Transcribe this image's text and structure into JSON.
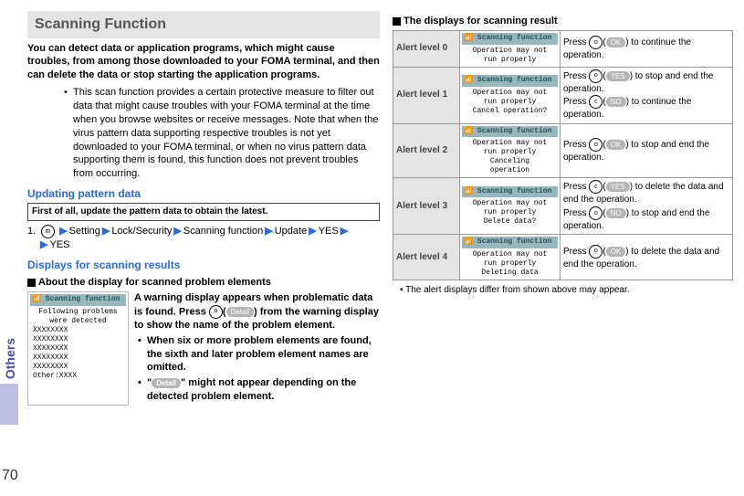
{
  "page_number": "70",
  "side_label": "Others",
  "left": {
    "title": "Scanning Function",
    "lead": "You can detect data or application programs, which might cause troubles, from among those downloaded to your FOMA terminal, and then can delete the data or stop starting the application programs.",
    "note": "This scan function provides a certain protective measure to filter out data that might cause troubles with your FOMA terminal at the time when you browse websites or receive messages. Note that when the virus pattern data supporting respective troubles is not yet downloaded to your FOMA terminal, or when no virus pattern data supporting them is found, this function does not prevent troubles from occurring.",
    "upd_heading": "Updating pattern data",
    "upd_box": "First of all, update the pattern data to obtain the latest.",
    "step_prefix": "1.",
    "icon_m": "m",
    "path": [
      "Setting",
      "Lock/Security",
      "Scanning function",
      "Update",
      "YES",
      "YES"
    ],
    "res_heading": "Displays for scanning results",
    "res_sub": "About the display for scanned problem elements",
    "phone": {
      "title": "Scanning function",
      "line1": "Following problems",
      "line2": "were detected",
      "items": [
        "XXXXXXXX",
        "XXXXXXXX",
        "XXXXXXXX",
        "XXXXXXXX",
        "XXXXXXXX",
        "Other:XXXX"
      ]
    },
    "res_text": {
      "p1a": "A warning display appears when problematic data is found. Press ",
      "circ": "o",
      "pill": "Detail",
      "p1b": ") from the warning display to show the name of the problem element.",
      "li1": "When six or more problem elements are found, the sixth and later problem element names are omitted.",
      "li2a": "\"",
      "li2_pill": "Detail",
      "li2b": "\" might not appear depending on the detected problem element."
    }
  },
  "right": {
    "header": "The displays for scanning result",
    "footer": "The alert displays differ from shown above may appear.",
    "phone_title": "Scanning function",
    "icons": {
      "o": "o",
      "c": "c"
    },
    "pills": {
      "ok": "OK",
      "yes": "YES",
      "no": "NO"
    },
    "rows": [
      {
        "label": "Alert level 0",
        "screen": "Operation may not\nrun properly",
        "acts": [
          {
            "pre": "Press ",
            "icon": "o",
            "pill": "ok",
            "post": ") to continue the operation."
          }
        ]
      },
      {
        "label": "Alert level 1",
        "screen": "Operation may not\nrun properly\nCancel operation?",
        "acts": [
          {
            "pre": "Press ",
            "icon": "o",
            "pill": "yes",
            "post": ") to stop and end the operation."
          },
          {
            "pre": "Press ",
            "icon": "c",
            "pill": "no",
            "post": ") to continue the operation."
          }
        ]
      },
      {
        "label": "Alert level 2",
        "screen": "Operation may not\nrun properly\nCanceling\noperation",
        "acts": [
          {
            "pre": "Press ",
            "icon": "o",
            "pill": "ok",
            "post": ") to stop and end the operation."
          }
        ]
      },
      {
        "label": "Alert level 3",
        "screen": "Operation may not\nrun properly\nDelete data?",
        "acts": [
          {
            "pre": "Press ",
            "icon": "c",
            "pill": "yes",
            "post": ") to delete the data and end the operation."
          },
          {
            "pre": "Press ",
            "icon": "o",
            "pill": "no",
            "post": ") to stop and end the operation."
          }
        ]
      },
      {
        "label": "Alert level 4",
        "screen": "Operation may not\nrun properly\nDeleting data",
        "acts": [
          {
            "pre": "Press ",
            "icon": "o",
            "pill": "ok",
            "post": ") to delete the data and end the operation."
          }
        ]
      }
    ]
  }
}
